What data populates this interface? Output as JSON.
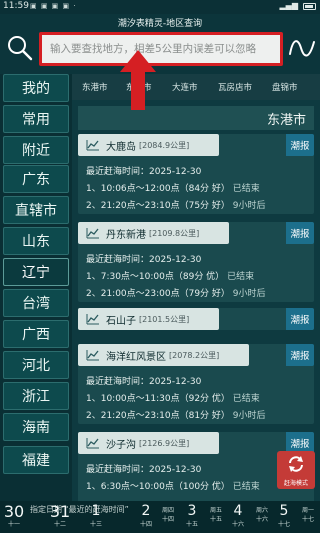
{
  "status_bar": {
    "time": "11:59",
    "icons": "▣ ▣ ▣ ▣ ·",
    "signal": "▂▄▆"
  },
  "header": {
    "title": "潮汐表精灵-地区查询",
    "search_placeholder": "输入要查找地方，相差5公里内误差可以忽略"
  },
  "regions": [
    "东港市",
    "东港市",
    "大连市",
    "瓦房店市",
    "盘锦市"
  ],
  "sidebar": {
    "items": [
      "我的",
      "常用",
      "附近",
      "广东",
      "直辖市",
      "山东",
      "辽宁",
      "台湾",
      "广西",
      "河北",
      "浙江",
      "海南",
      "福建"
    ],
    "active_index": 6
  },
  "city_header": "东港市",
  "cards": [
    {
      "name": "大鹿岛",
      "distance": "[2084.9公里]",
      "tide_label": "潮报",
      "lines": [
        {
          "text": "最近赶海时间：2025-12-30",
          "status": ""
        },
        {
          "text": "1、10:06点～12:00点（84分 好）",
          "status": "已结束"
        },
        {
          "text": "2、21:20点～23:10点（75分 好）",
          "status": "9小时后"
        }
      ]
    },
    {
      "name": "丹东新港",
      "distance": "[2109.8公里]",
      "tide_label": "潮报",
      "lines": [
        {
          "text": "最近赶海时间：2025-12-30",
          "status": ""
        },
        {
          "text": "1、7:30点～10:00点（89分 优）",
          "status": "已结束"
        },
        {
          "text": "2、21:00点～23:00点（79分 好）",
          "status": "9小时后"
        }
      ]
    },
    {
      "name": "石山子",
      "distance": "[2101.5公里]",
      "tide_label": "潮报",
      "lines": []
    },
    {
      "name": "海洋红风景区",
      "distance": "[2078.2公里]",
      "tide_label": "潮报",
      "lines": [
        {
          "text": "最近赶海时间：2025-12-30",
          "status": ""
        },
        {
          "text": "1、10:00点～11:30点（92分 优）",
          "status": "已结束"
        },
        {
          "text": "2、21:20点～23:10点（81分 好）",
          "status": "9小时后"
        }
      ]
    },
    {
      "name": "沙子沟",
      "distance": "[2126.9公里]",
      "tide_label": "潮报",
      "lines": [
        {
          "text": "最近赶海时间：2025-12-30",
          "status": ""
        },
        {
          "text": "1、6:30点～10:00点（100分 优）",
          "status": "已结束"
        }
      ]
    }
  ],
  "float_button": {
    "label": "赶海模式"
  },
  "date_bar": {
    "note": "指定日期 “最近的赶海时间”",
    "days": [
      {
        "num": "30",
        "sub": "十一"
      },
      {
        "num": "31",
        "sub": "十二"
      },
      {
        "num": "1",
        "sub": "十三"
      },
      {
        "num": "2",
        "sub": "十四"
      },
      {
        "num": "3",
        "sub": "十五"
      },
      {
        "num": "4",
        "sub": "十六"
      },
      {
        "num": "5",
        "sub": "十七"
      }
    ],
    "weekdays": [
      "周四",
      "周五",
      "周六",
      "周日",
      "周一"
    ]
  },
  "colors": {
    "accent_red": "#d51f23",
    "tide_button": "#1c6f8c",
    "float_button": "#c43b37"
  }
}
